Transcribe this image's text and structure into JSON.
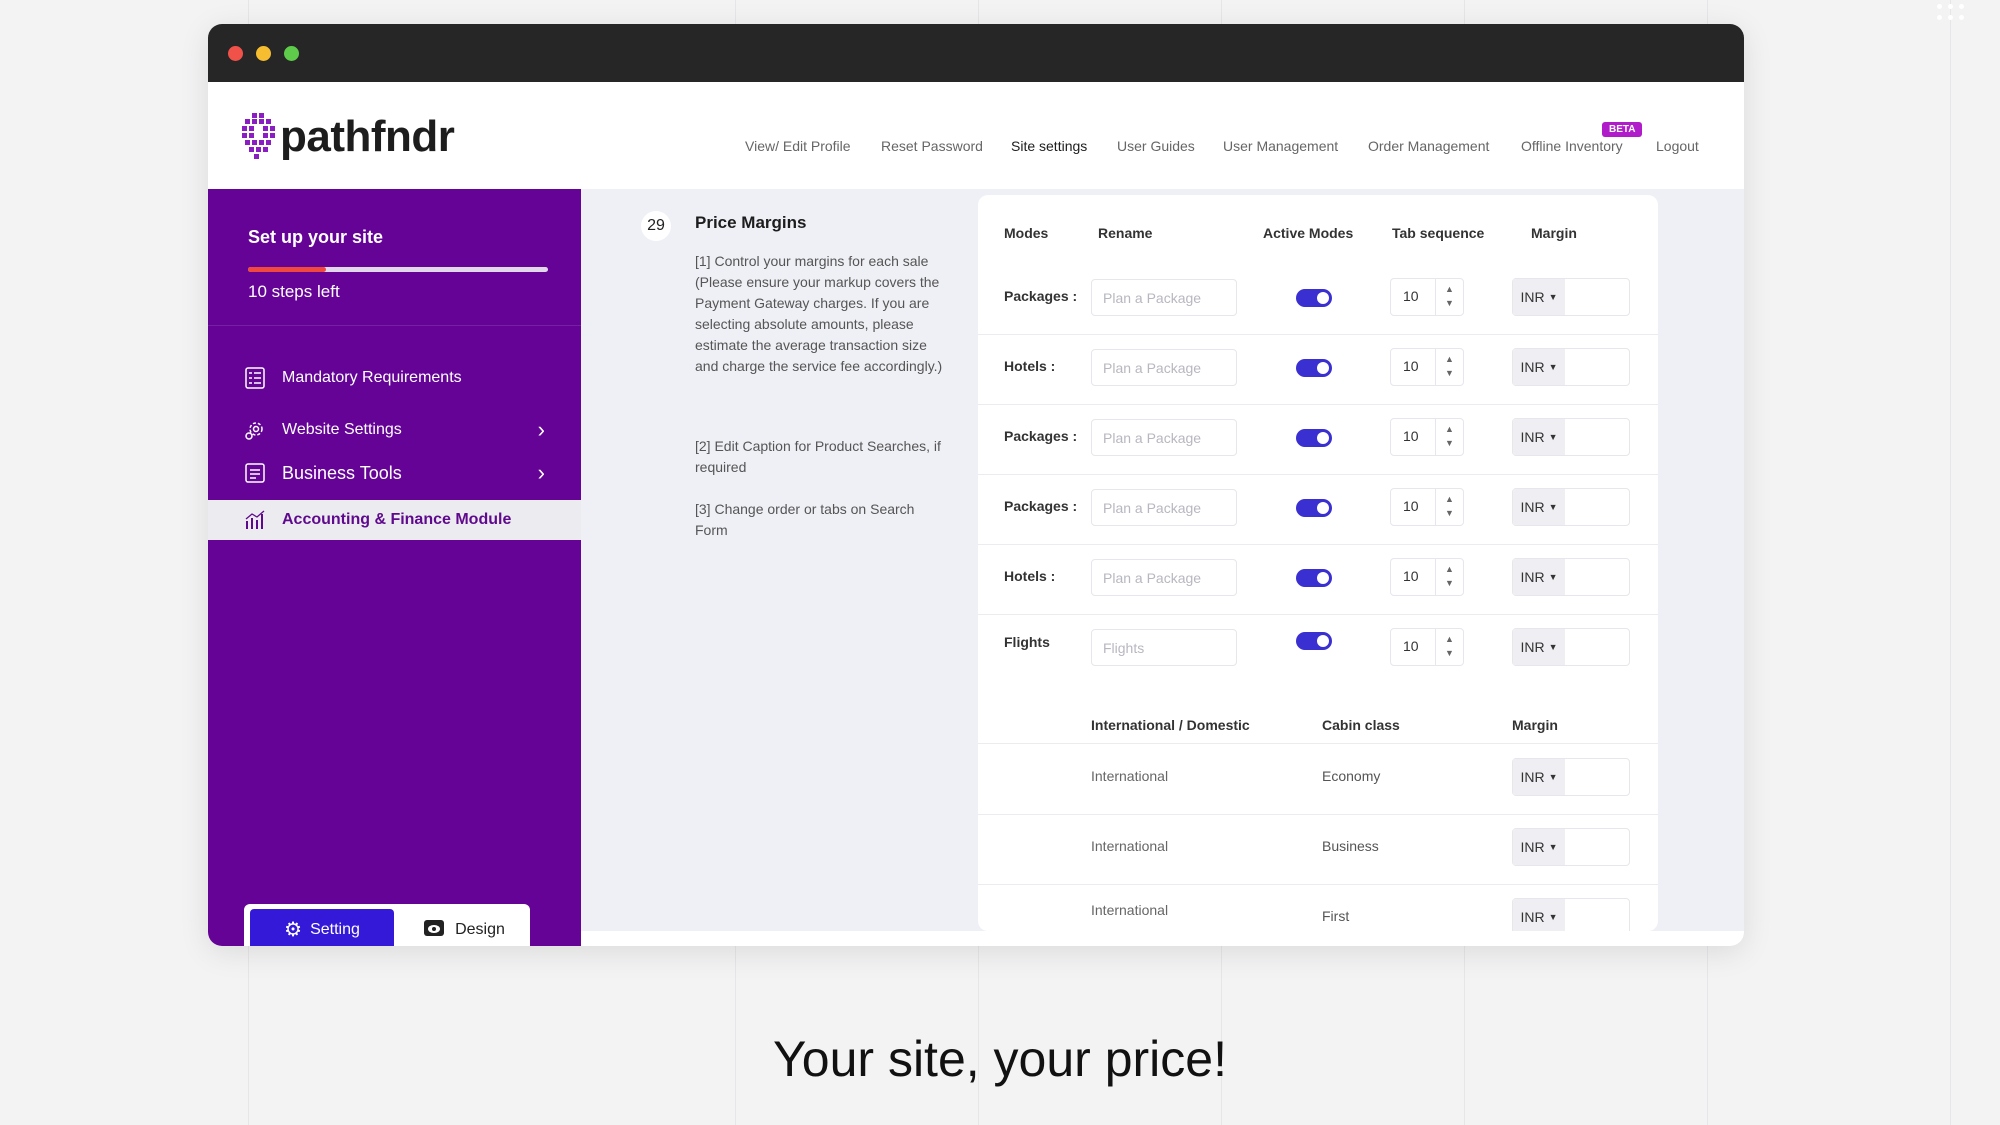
{
  "app": {
    "logo_text": "pathfndr"
  },
  "nav": {
    "items": [
      "View/ Edit Profile",
      "Reset Password",
      "Site settings",
      "User Guides",
      "User Management",
      "Order Management",
      "Offline Inventory",
      "Logout"
    ],
    "active": "Site settings",
    "beta_badge": "BETA"
  },
  "sidebar": {
    "title": "Set up your site",
    "progress_fraction": 0.26,
    "steps_left": "10 steps left",
    "items": [
      {
        "label": "Mandatory Requirements",
        "icon": "checklist-icon"
      },
      {
        "label": "Website Settings",
        "icon": "gear-icon",
        "has_chevron": true
      },
      {
        "label": "Business Tools",
        "icon": "tools-icon",
        "has_chevron": true
      },
      {
        "label": "Accounting & Finance Module",
        "icon": "chart-icon",
        "active": true
      }
    ],
    "toggle": {
      "setting": "Setting",
      "design": "Design",
      "selected": "Setting"
    }
  },
  "main": {
    "step_number": "29",
    "title": "Price Margins",
    "notes": [
      "[1] Control your margins for each sale (Please ensure your markup covers the Payment Gateway charges. If you are selecting absolute amounts, please estimate the average transaction size and charge the service fee accordingly.)",
      "[2] Edit Caption for Product Searches, if required",
      "[3] Change order or tabs on Search Form"
    ],
    "table": {
      "headers": [
        "Modes",
        "Rename",
        "Active Modes",
        "Tab sequence",
        "Margin"
      ],
      "rows": [
        {
          "mode": "Packages :",
          "placeholder": "Plan a Package",
          "active": true,
          "sequence": "10",
          "currency": "INR"
        },
        {
          "mode": "Hotels :",
          "placeholder": "Plan a Package",
          "active": true,
          "sequence": "10",
          "currency": "INR"
        },
        {
          "mode": "Packages :",
          "placeholder": "Plan a Package",
          "active": true,
          "sequence": "10",
          "currency": "INR"
        },
        {
          "mode": "Packages :",
          "placeholder": "Plan a Package",
          "active": true,
          "sequence": "10",
          "currency": "INR"
        },
        {
          "mode": "Hotels :",
          "placeholder": "Plan a Package",
          "active": true,
          "sequence": "10",
          "currency": "INR"
        },
        {
          "mode": "Flights",
          "placeholder": "Flights",
          "active": true,
          "sequence": "10",
          "currency": "INR"
        }
      ]
    },
    "flight_table": {
      "headers": [
        "International / Domestic",
        "Cabin class",
        "Margin"
      ],
      "rows": [
        {
          "region": "International",
          "cabin": "Economy",
          "currency": "INR"
        },
        {
          "region": "International",
          "cabin": "Business",
          "currency": "INR"
        },
        {
          "region": "International",
          "cabin": "First",
          "currency": "INR"
        }
      ]
    }
  },
  "tagline": "Your site, your price!",
  "colors": {
    "sidebar_bg": "#640396",
    "accent_blue": "#3519d9",
    "toggle_on": "#3a2fd0",
    "progress": "#f0483e",
    "beta": "#b01cc9"
  }
}
